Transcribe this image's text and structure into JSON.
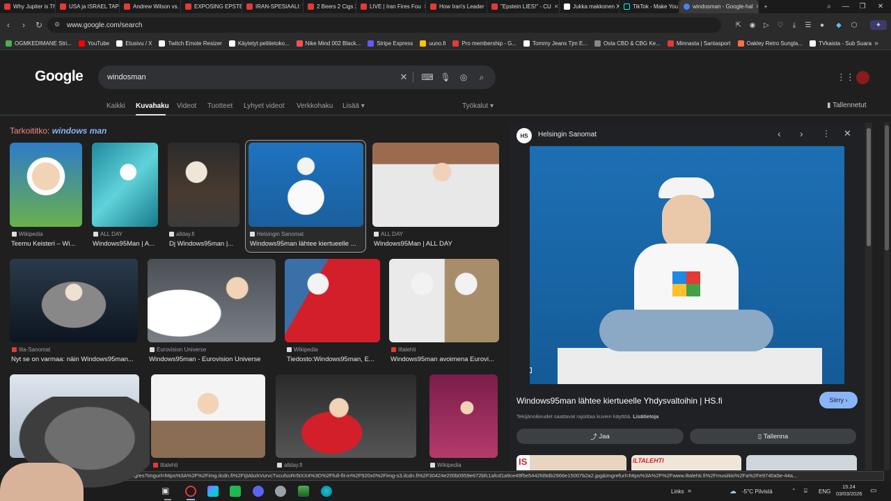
{
  "browser": {
    "tabs": [
      {
        "label": "Why Jupiter is The"
      },
      {
        "label": "USA ja ISRAEL TAPP"
      },
      {
        "label": "Andrew Wilson vs."
      },
      {
        "label": "EXPOSING EPSTEIN"
      },
      {
        "label": "IRAN-SPESIAALI: Tr"
      },
      {
        "label": "2 Beers 2 Cigs 2 Ru"
      },
      {
        "label": "LIVE | Iran Fires Fou"
      },
      {
        "label": "How Iran's Leader"
      },
      {
        "label": "\"Epstein LIES!\" - CU"
      },
      {
        "label": "Jukka makkonen X"
      },
      {
        "label": "TikTok - Make You"
      },
      {
        "label": "windosman - Google-hal"
      }
    ],
    "url": "www.google.com/search",
    "bookmarks": [
      {
        "label": "OGMKEDIMANE Stri...",
        "color": "#4caf50"
      },
      {
        "label": "YouTube",
        "color": "#ff0000"
      },
      {
        "label": "Etusivu / X",
        "color": "#ffffff"
      },
      {
        "label": "Twitch Emote Resizer",
        "color": "#ffffff"
      },
      {
        "label": "Käytetyt pelitietoko...",
        "color": "#ffffff"
      },
      {
        "label": "Nike Mind 002 Black...",
        "color": "#ff5252"
      },
      {
        "label": "Stripe Express",
        "color": "#635bff"
      },
      {
        "label": "uuno.fi",
        "color": "#ffc107"
      },
      {
        "label": "Pro membership - G...",
        "color": "#e53935"
      },
      {
        "label": "Tommy Jeans Tjm E...",
        "color": "#ffffff"
      },
      {
        "label": "Osta CBD & CBG Ke...",
        "color": "#888888"
      },
      {
        "label": "Minnasta | Santasport",
        "color": "#e53935"
      },
      {
        "label": "Oakley Retro Sungla...",
        "color": "#ff7043"
      },
      {
        "label": "TVkaista - Sub Suara",
        "color": "#ffffff"
      }
    ]
  },
  "google": {
    "logo": "Google",
    "query": "windosman",
    "tabs": [
      "Kaikki",
      "Kuvahaku",
      "Videot",
      "Tuotteet",
      "Lyhyet videot",
      "Verkkohaku",
      "Lisää"
    ],
    "tools": "Työkalut",
    "saved": "Tallennetut",
    "did_you_mean_prefix": "Tarkoititko: ",
    "did_you_mean_term": "windows man"
  },
  "results": [
    {
      "source": "Wikipedia",
      "caption": "Teemu Keisteri – Wi..."
    },
    {
      "source": "ALL DAY",
      "caption": "Windows95Man | A..."
    },
    {
      "source": "allday.fi",
      "caption": "Dj Windows95man |..."
    },
    {
      "source": "Helsingin Sanomat",
      "caption": "Windows95man lähtee kiertueelle ..."
    },
    {
      "source": "ALL DAY",
      "caption": "Windows95Man | ALL DAY"
    },
    {
      "source": "Ilta-Sanomat",
      "caption": "Nyt se on varmaa: näin Windows95man..."
    },
    {
      "source": "Eurovision Universe",
      "caption": "Windows95man - Eurovision Universe"
    },
    {
      "source": "Wikipedia",
      "caption": "Tiedosto:Windows95man, E..."
    },
    {
      "source": "Iltalehti",
      "caption": "Windows95man avoimena Eurovi..."
    },
    {
      "source": "",
      "caption": ""
    },
    {
      "source": "Iltalehti",
      "caption": ""
    },
    {
      "source": "allday.fi",
      "caption": ""
    },
    {
      "source": "Wikipedia",
      "caption": ""
    }
  ],
  "panel": {
    "source": "Helsingin Sanomat",
    "title": "Windows95man lähtee kiertueelle Yhdysvaltoihin | HS.fi",
    "copyright": "Tekijänoikeudet saattavat rajoittaa kuvien käyttöä.",
    "copyright_link": "Lisätietoja",
    "visit": "Siirry",
    "share": "Jaa",
    "save": "Tallenna"
  },
  "status_url": "/imgres?imgurl=https%3A%2F%2Fimg.ilcdn.fi%2FIjIAbzkVurvcTxcufssRr5tXX4%3D%2Ffull-fit-in%2F920x0%2Fimg-s3.ilcdn.fi%2F30424e200b0959e672bfc1afcd1a9ce49f5e5442fd9db2966e15007b2a2.jpg&imgrefurl=https%3A%2F%2Fwww.iltalehti.fi%2Fmusiikki%2Fa%2Fe9740a5e-44a...",
  "taskbar": {
    "links": "Links",
    "weather": "-5°C Pilvistä",
    "lang": "ENG",
    "time": "15.24",
    "date": "03/03/2026"
  }
}
